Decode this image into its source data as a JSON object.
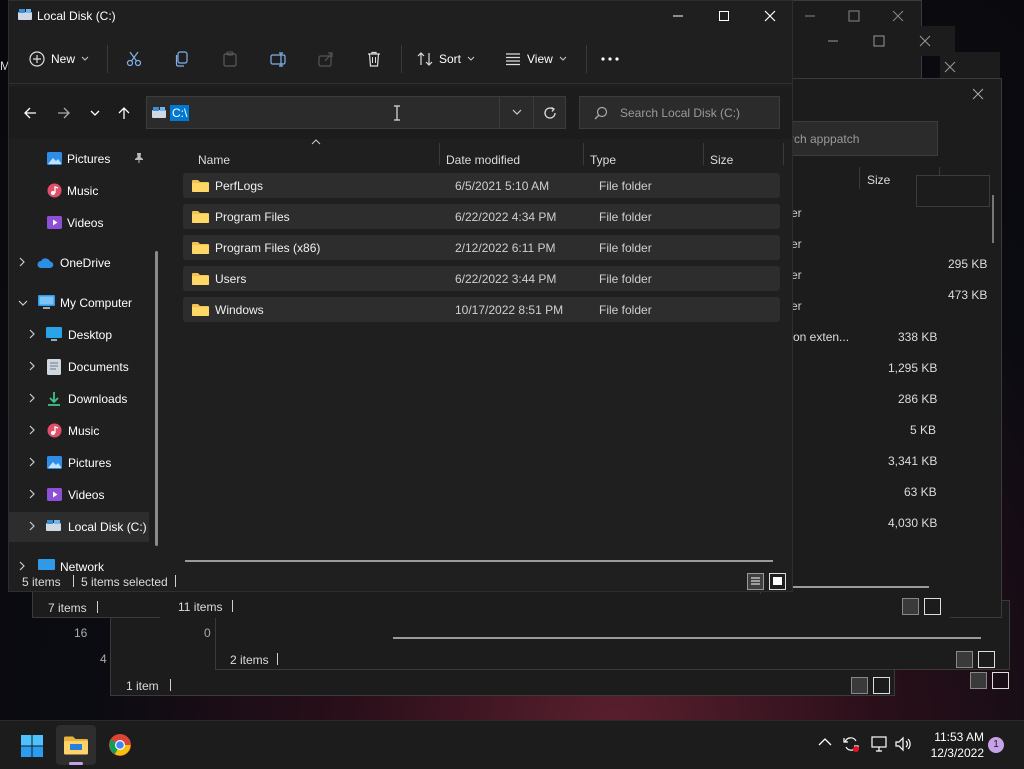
{
  "main_window": {
    "title": "Local Disk (C:)",
    "toolbar": {
      "new": "New",
      "sort": "Sort",
      "view": "View"
    },
    "address": {
      "value": "C:\\"
    },
    "search": {
      "placeholder": "Search Local Disk (C:)"
    },
    "sidebar": {
      "items": [
        {
          "label": "Pictures"
        },
        {
          "label": "Music"
        },
        {
          "label": "Videos"
        },
        {
          "label": "OneDrive"
        },
        {
          "label": "My Computer"
        },
        {
          "label": "Desktop"
        },
        {
          "label": "Documents"
        },
        {
          "label": "Downloads"
        },
        {
          "label": "Music"
        },
        {
          "label": "Pictures"
        },
        {
          "label": "Videos"
        },
        {
          "label": "Local Disk (C:)"
        },
        {
          "label": "Network"
        }
      ]
    },
    "columns": {
      "name": "Name",
      "date": "Date modified",
      "type": "Type",
      "size": "Size"
    },
    "rows": [
      {
        "name": "PerfLogs",
        "date": "6/5/2021 5:10 AM",
        "type": "File folder"
      },
      {
        "name": "Program Files",
        "date": "6/22/2022 4:34 PM",
        "type": "File folder"
      },
      {
        "name": "Program Files (x86)",
        "date": "2/12/2022 6:11 PM",
        "type": "File folder"
      },
      {
        "name": "Users",
        "date": "6/22/2022 3:44 PM",
        "type": "File folder"
      },
      {
        "name": "Windows",
        "date": "10/17/2022 8:51 PM",
        "type": "File folder"
      }
    ],
    "status": {
      "count": "5 items",
      "selected": "5 items selected"
    }
  },
  "bg_window_1": {
    "search_partial": "rch apppatch",
    "size_header": "Size",
    "partial_texts": [
      "er",
      "er",
      "er",
      "er",
      "on exten..."
    ],
    "sizes": [
      "295 KB",
      "473 KB",
      "338 KB",
      "1,295 KB",
      "286 KB",
      "5 KB",
      "3,341 KB",
      "63 KB",
      "4,030 KB"
    ],
    "status": "11 items"
  },
  "bg_window_other": {
    "left_edge_letter": "M",
    "status_a": "7 items",
    "status_b": "2 items",
    "status_c": "1 item",
    "partial_16": "16",
    "partial_0": "0",
    "partial_4": "4"
  },
  "taskbar": {
    "time": "11:53 AM",
    "date": "12/3/2022",
    "notification_count": "1"
  }
}
